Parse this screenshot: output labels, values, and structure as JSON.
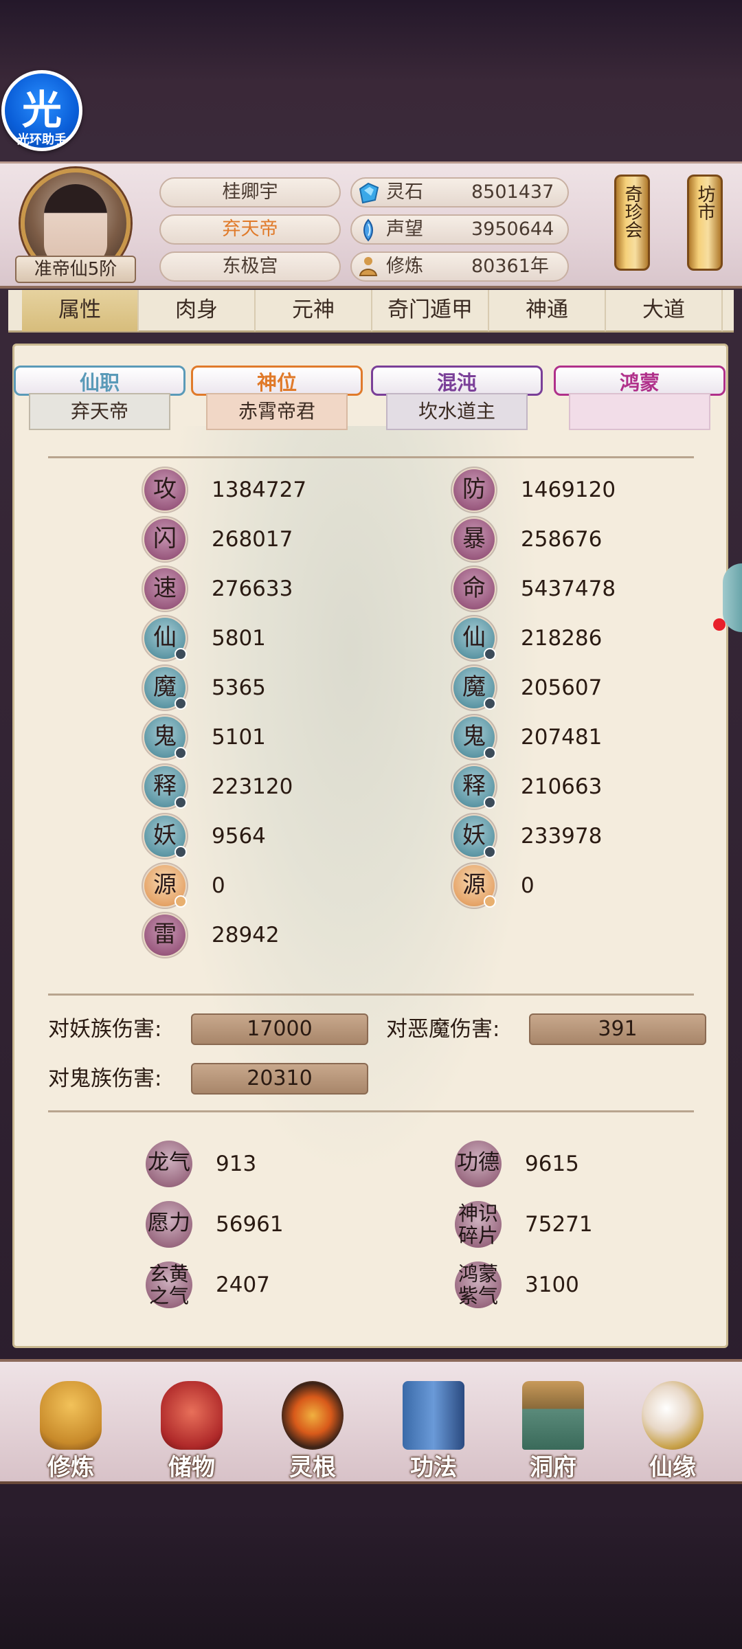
{
  "helper": {
    "glyph": "光",
    "label": "光环助手"
  },
  "profile": {
    "rank": "准帝仙5阶",
    "names": [
      "桂卿宇",
      "弃天帝",
      "东极宫"
    ],
    "name_colors": [
      "#4a3a30",
      "#e07a2a",
      "#4a3a30"
    ]
  },
  "resources": [
    {
      "label": "灵石",
      "value": "8501437",
      "icon": "spirit-stone-icon"
    },
    {
      "label": "声望",
      "value": "3950644",
      "icon": "prestige-icon"
    },
    {
      "label": "修炼",
      "value": "80361年",
      "icon": "cultivation-icon"
    }
  ],
  "side_buttons": [
    {
      "label": "奇珍会"
    },
    {
      "label": "坊市"
    }
  ],
  "tabs": [
    "属性",
    "肉身",
    "元神",
    "奇门遁甲",
    "神通",
    "大道"
  ],
  "active_tab": 0,
  "rank_tabs": [
    {
      "title": "仙职",
      "value": "弃天帝",
      "color": "#5a9ab8"
    },
    {
      "title": "神位",
      "value": "赤霄帝君",
      "color": "#e07a2a"
    },
    {
      "title": "混沌",
      "value": "坎水道主",
      "color": "#7a3f98"
    },
    {
      "title": "鸿蒙",
      "value": "",
      "color": "#b0308a"
    }
  ],
  "stats_left": [
    {
      "icon": "攻",
      "value": "1384727",
      "style": "purple"
    },
    {
      "icon": "闪",
      "value": "268017",
      "style": "purple"
    },
    {
      "icon": "速",
      "value": "276633",
      "style": "purple"
    },
    {
      "icon": "仙",
      "value": "5801",
      "style": "teal"
    },
    {
      "icon": "魔",
      "value": "5365",
      "style": "teal"
    },
    {
      "icon": "鬼",
      "value": "5101",
      "style": "teal"
    },
    {
      "icon": "释",
      "value": "223120",
      "style": "teal"
    },
    {
      "icon": "妖",
      "value": "9564",
      "style": "teal"
    },
    {
      "icon": "源",
      "value": "0",
      "style": "orange"
    },
    {
      "icon": "雷",
      "value": "28942",
      "style": "purple"
    }
  ],
  "stats_right": [
    {
      "icon": "防",
      "value": "1469120",
      "style": "purple"
    },
    {
      "icon": "暴",
      "value": "258676",
      "style": "purple"
    },
    {
      "icon": "命",
      "value": "5437478",
      "style": "purple"
    },
    {
      "icon": "仙",
      "value": "218286",
      "style": "teal"
    },
    {
      "icon": "魔",
      "value": "205607",
      "style": "teal"
    },
    {
      "icon": "鬼",
      "value": "207481",
      "style": "teal"
    },
    {
      "icon": "释",
      "value": "210663",
      "style": "teal"
    },
    {
      "icon": "妖",
      "value": "233978",
      "style": "teal"
    },
    {
      "icon": "源",
      "value": "0",
      "style": "orange"
    }
  ],
  "damage": [
    {
      "label": "对妖族伤害:",
      "value": "17000"
    },
    {
      "label": "对恶魔伤害:",
      "value": "391"
    },
    {
      "label": "对鬼族伤害:",
      "value": "20310"
    }
  ],
  "misc": [
    {
      "label": "龙气",
      "value": "913"
    },
    {
      "label": "功德",
      "value": "9615"
    },
    {
      "label": "愿力",
      "value": "56961"
    },
    {
      "label": "神识碎片",
      "value": "75271"
    },
    {
      "label": "玄黄之气",
      "value": "2407"
    },
    {
      "label": "鸿蒙紫气",
      "value": "3100"
    }
  ],
  "bottom_nav": [
    "修炼",
    "储物",
    "灵根",
    "功法",
    "洞府",
    "仙缘"
  ]
}
